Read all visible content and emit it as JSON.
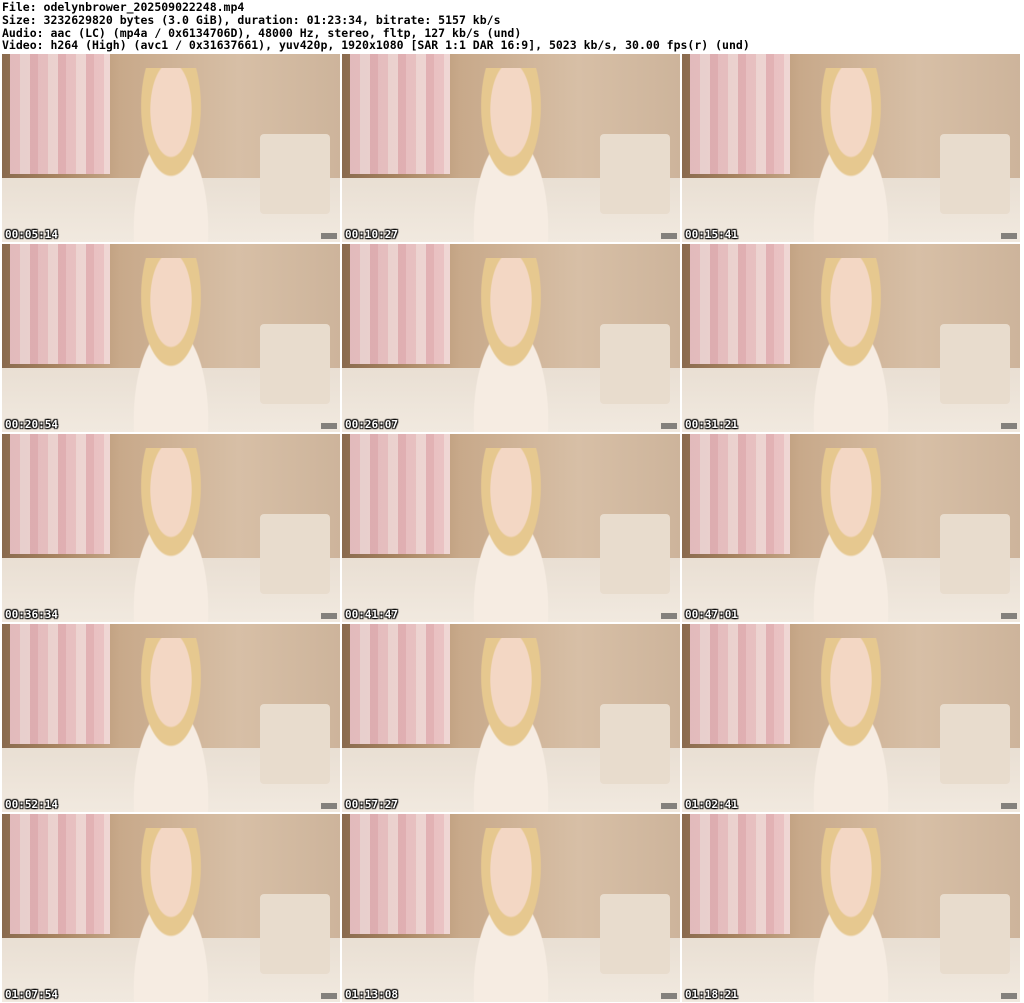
{
  "header": {
    "file": "File: odelynbrower_202509022248.mp4",
    "size": "Size: 3232629820 bytes (3.0 GiB), duration: 01:23:34, bitrate: 5157 kb/s",
    "audio": "Audio: aac (LC) (mp4a / 0x6134706D), 48000 Hz, stereo, fltp, 127 kb/s (und)",
    "video": "Video: h264 (High) (avc1 / 0x31637661), yuv420p, 1920x1080 [SAR 1:1 DAR 16:9], 5023 kb/s, 30.00 fps(r) (und)"
  },
  "thumbnails": [
    {
      "timestamp": "00:05:14"
    },
    {
      "timestamp": "00:10:27"
    },
    {
      "timestamp": "00:15:41"
    },
    {
      "timestamp": "00:20:54"
    },
    {
      "timestamp": "00:26:07"
    },
    {
      "timestamp": "00:31:21"
    },
    {
      "timestamp": "00:36:34"
    },
    {
      "timestamp": "00:41:47"
    },
    {
      "timestamp": "00:47:01"
    },
    {
      "timestamp": "00:52:14"
    },
    {
      "timestamp": "00:57:27"
    },
    {
      "timestamp": "01:02:41"
    },
    {
      "timestamp": "01:07:54"
    },
    {
      "timestamp": "01:13:08"
    },
    {
      "timestamp": "01:18:21"
    }
  ]
}
